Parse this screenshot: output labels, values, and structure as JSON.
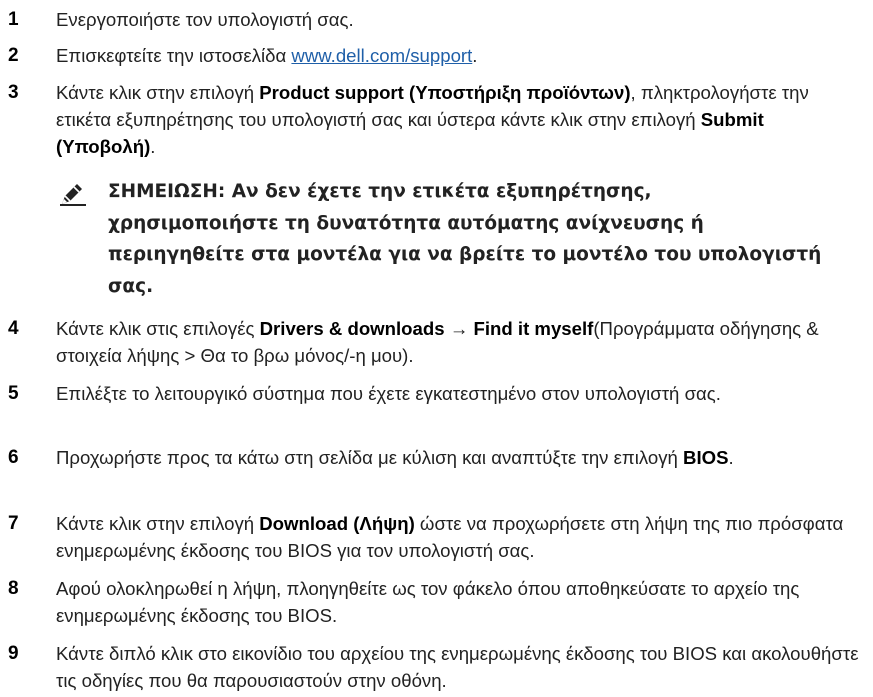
{
  "steps": [
    {
      "number": "1",
      "text": "Ενεργοποιήστε τον υπολογιστή σας."
    },
    {
      "number": "2",
      "prefix": "Επισκεφτείτε την ιστοσελίδα ",
      "link": "www.dell.com/support",
      "suffix": "."
    },
    {
      "number": "3",
      "part1": "Κάντε κλικ στην επιλογή ",
      "bold1": "Product support (Υποστήριξη προϊόντων)",
      "part2": ", πληκτρολογήστε την ετικέτα εξυπηρέτησης του υπολογιστή σας και ύστερα κάντε κλικ στην επιλογή ",
      "bold2": "Submit (Υποβολή)",
      "part3": "."
    },
    {
      "number": "4",
      "part1": "Κάντε κλικ στις επιλογές ",
      "bold1": "Drivers & downloads",
      "arrow": " → ",
      "bold2": "Find it myself",
      "part2": "(Προγράμματα οδήγησης & στοιχεία λήψης > Θα το βρω μόνος/-η μου)."
    },
    {
      "number": "5",
      "text": "Επιλέξτε το λειτουργικό σύστημα που έχετε εγκατεστημένο στον υπολογιστή σας."
    },
    {
      "number": "6",
      "part1": "Προχωρήστε προς τα κάτω στη σελίδα με κύλιση και αναπτύξτε την επιλογή ",
      "bold1": "BIOS",
      "part2": "."
    },
    {
      "number": "7",
      "part1": "Κάντε κλικ στην επιλογή ",
      "bold1": "Download (Λήψη)",
      "part2": " ώστε να προχωρήσετε στη λήψη της πιο πρόσφατα ενημερωμένης έκδοσης του BIOS για τον υπολογιστή σας."
    },
    {
      "number": "8",
      "text": "Αφού ολοκληρωθεί η λήψη, πλοηγηθείτε ως τον φάκελο όπου αποθηκεύσατε το αρχείο της ενημερωμένης έκδοσης του BIOS."
    },
    {
      "number": "9",
      "text": "Κάντε διπλό κλικ στο εικονίδιο του αρχείου της ενημερωμένης έκδοσης του BIOS και ακολουθήστε τις οδηγίες που θα παρουσιαστούν στην οθόνη."
    }
  ],
  "note": {
    "icon": "pencil-note-icon",
    "text": "ΣΗΜΕΙΩΣΗ: Αν δεν έχετε την ετικέτα εξυπηρέτησης, χρησιμοποιήστε τη δυνατότητα αυτόματης ανίχνευσης ή περιηγηθείτε στα μοντέλα για να βρείτε το μοντέλο του υπολογιστή σας."
  },
  "colors": {
    "link": "#1f5fa8",
    "text": "#222222"
  }
}
